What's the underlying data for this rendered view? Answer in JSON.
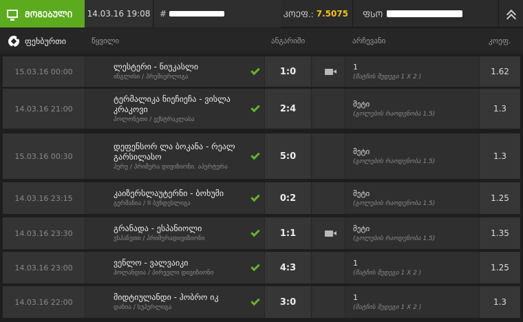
{
  "topbar": {
    "status": "ᲛᲝᲒᲔᲑᲣᲚᲘ",
    "date": "14.03.16 19:08",
    "id_prefix": "#",
    "odds_label": "ᲙᲝᲔᲤ.:",
    "odds_value": "7.5075",
    "price_label": "ᲤᲡᲝ"
  },
  "header": {
    "sport": "ფეხბურთი",
    "col_event": "წყვილი",
    "col_score": "ანგარიში",
    "col_choice": "არჩევანი",
    "col_odds": "კოეფ."
  },
  "colors": {
    "accent": "#5cab1f",
    "odds_highlight": "#f0c419",
    "check": "#68b32c"
  },
  "bets": [
    {
      "date": "15.03.16 00:00",
      "teams": "ლესტერი - ნიუკასლი",
      "league": "ინგლისი / პრემიერლიგა",
      "score": "1:0",
      "video": true,
      "pick": "1",
      "pick_desc": "(მატჩის შედეგი 1 X 2 )",
      "odds": "1.62"
    },
    {
      "date": "14.03.16 21:00",
      "teams": "ტერმალიკა ნიეჩიეჩა - ვისლა კრაკოვი",
      "league": "პოლონეთი / ექსტრაკლასა",
      "score": "2:4",
      "video": false,
      "pick": "მეტი",
      "pick_desc": "(გოლების რაოდენობა 1.5)",
      "odds": "1.3"
    },
    {
      "date": "15.03.16 00:30",
      "teams": "დეფენსორ ლა ბოკანა - რეალ გარსილასო",
      "league": "პერუ / პრიმერა დივიზიონი. აპერტურა",
      "score": "5:0",
      "video": false,
      "pick": "მეტი",
      "pick_desc": "(გოლების რაოდენობა 1.5)",
      "odds": "1.3"
    },
    {
      "date": "14.03.16 23:15",
      "teams": "კაიზერსლაუტერნი - ბოხუმი",
      "league": "გერმანია / II ბუნდესლიგა",
      "score": "0:2",
      "video": false,
      "pick": "მეტი",
      "pick_desc": "(გოლების რაოდენობა 1.5)",
      "odds": "1.25"
    },
    {
      "date": "14.03.16 23:30",
      "teams": "გრანადა - ესპანიოლი",
      "league": "ესპანეთი / პრიმერადივიზიონი",
      "score": "1:1",
      "video": true,
      "pick": "მეტი",
      "pick_desc": "(გოლების რაოდენობა 1.5)",
      "odds": "1.35"
    },
    {
      "date": "14.03.16 23:00",
      "teams": "ვენლო - ვალვაიკი",
      "league": "ჰოლანდია / პირველი დივიზიონი",
      "score": "4:3",
      "video": false,
      "pick": "1",
      "pick_desc": "(მატჩის შედეგი 1 X 2 )",
      "odds": "1.25"
    },
    {
      "date": "14.03.16 22:00",
      "teams": "მიდტიულანდი - ჰობრო იკ",
      "league": "დანია / სუპერლიგა",
      "score": "3:0",
      "video": false,
      "pick": "1",
      "pick_desc": "(მატჩის შედეგი 1 X 2 )",
      "odds": "1.3"
    }
  ]
}
